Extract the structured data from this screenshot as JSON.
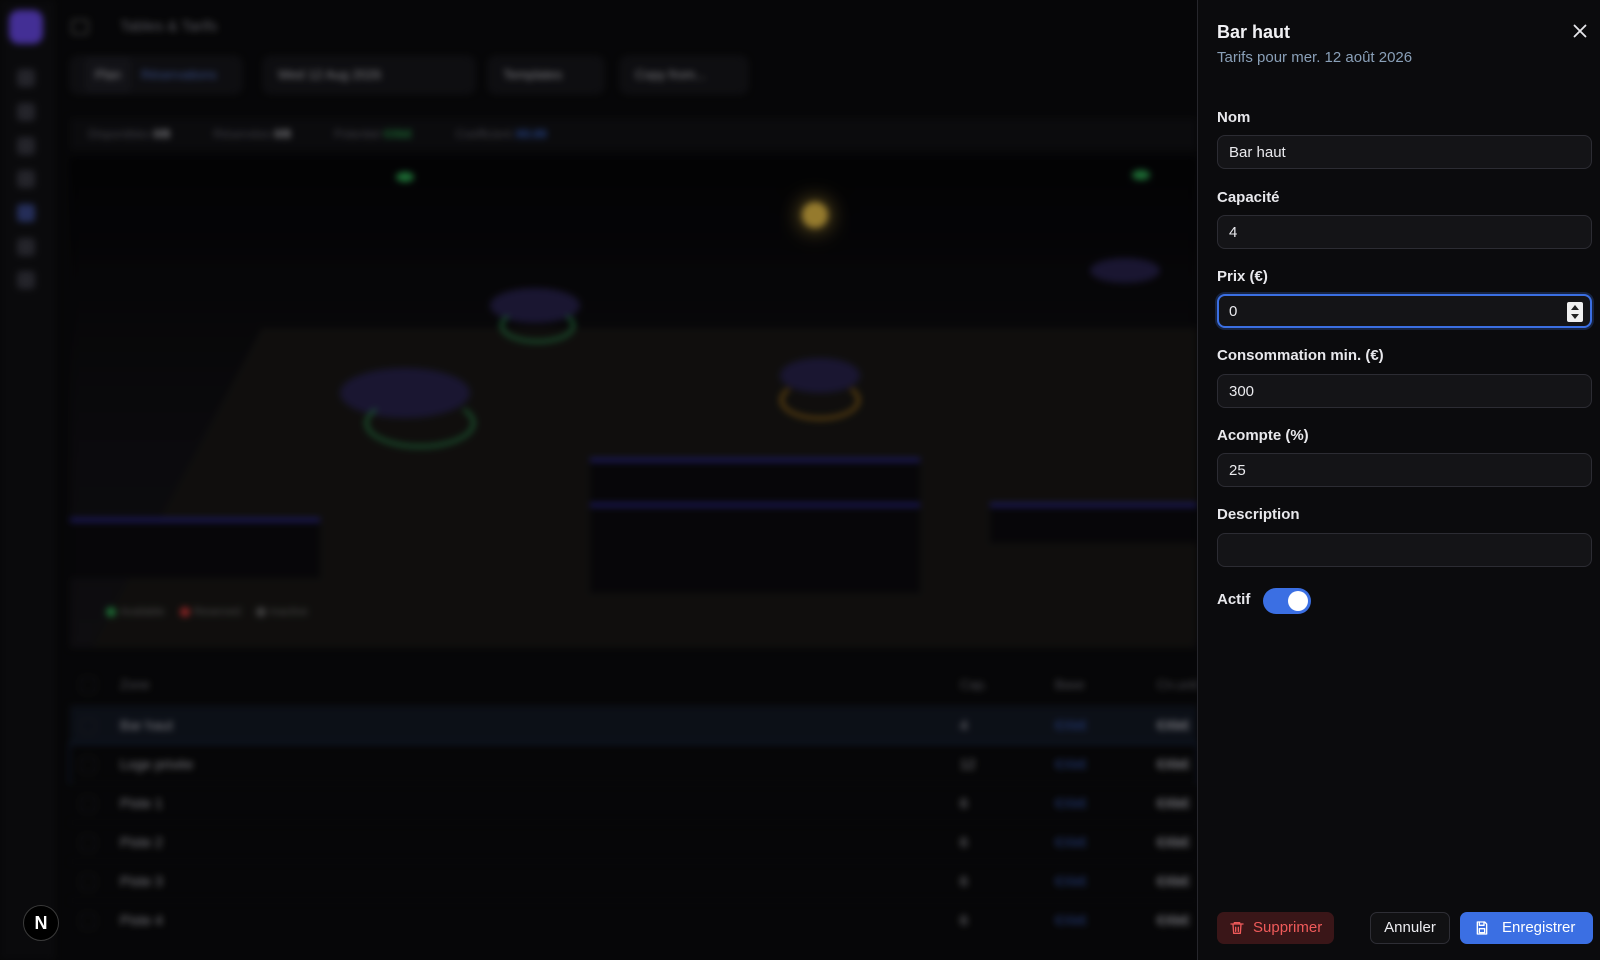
{
  "background": {
    "page_title": "Tables & Tarifs",
    "tabs": [
      "Plan",
      "Réservations"
    ],
    "date_label": "Wed 12 Aug 2026",
    "templates_label": "Templates",
    "copy_label": "Copy from...",
    "stats": [
      {
        "label": "Disponibles",
        "value": "0/8"
      },
      {
        "label": "Réservées",
        "value": "0/8"
      },
      {
        "label": "Potentiel",
        "value": "€Xk€"
      },
      {
        "label": "Coefficient",
        "value": "X0.00"
      }
    ],
    "legend": [
      "Available",
      "Reserved",
      "Inactive"
    ],
    "table": {
      "headers": [
        "Zone",
        "Cap.",
        "Base",
        "Cn.unit"
      ],
      "rows": [
        {
          "name": "Bar haut",
          "cap": "4",
          "base": "€Xk€",
          "min": "€Xk€"
        },
        {
          "name": "Loge privée",
          "cap": "12",
          "base": "€Xk€",
          "min": "€Xk€"
        },
        {
          "name": "Piste 1",
          "cap": "6",
          "base": "€Xk€",
          "min": "€Xk€"
        },
        {
          "name": "Piste 2",
          "cap": "6",
          "base": "€Xk€",
          "min": "€Xk€"
        },
        {
          "name": "Piste 3",
          "cap": "6",
          "base": "€Xk€",
          "min": "€Xk€"
        },
        {
          "name": "Piste 4",
          "cap": "6",
          "base": "€Xk€",
          "min": "€Xk€"
        }
      ]
    },
    "badge": "N"
  },
  "sheet": {
    "title": "Bar haut",
    "subtitle": "Tarifs pour mer. 12 août 2026",
    "fields": {
      "nom": {
        "label": "Nom",
        "value": "Bar haut"
      },
      "capacite": {
        "label": "Capacité",
        "value": "4"
      },
      "prix": {
        "label": "Prix (€)",
        "value": "0"
      },
      "consommation": {
        "label": "Consommation min. (€)",
        "value": "300"
      },
      "acompte": {
        "label": "Acompte (%)",
        "value": "25"
      },
      "description": {
        "label": "Description",
        "value": ""
      }
    },
    "actif": {
      "label": "Actif",
      "checked": true
    },
    "buttons": {
      "delete": "Supprimer",
      "cancel": "Annuler",
      "save": "Enregistrer"
    }
  },
  "colors": {
    "accent": "#3b6fe3",
    "danger": "#ef5a5a",
    "subtitle": "#8aa0b8"
  }
}
